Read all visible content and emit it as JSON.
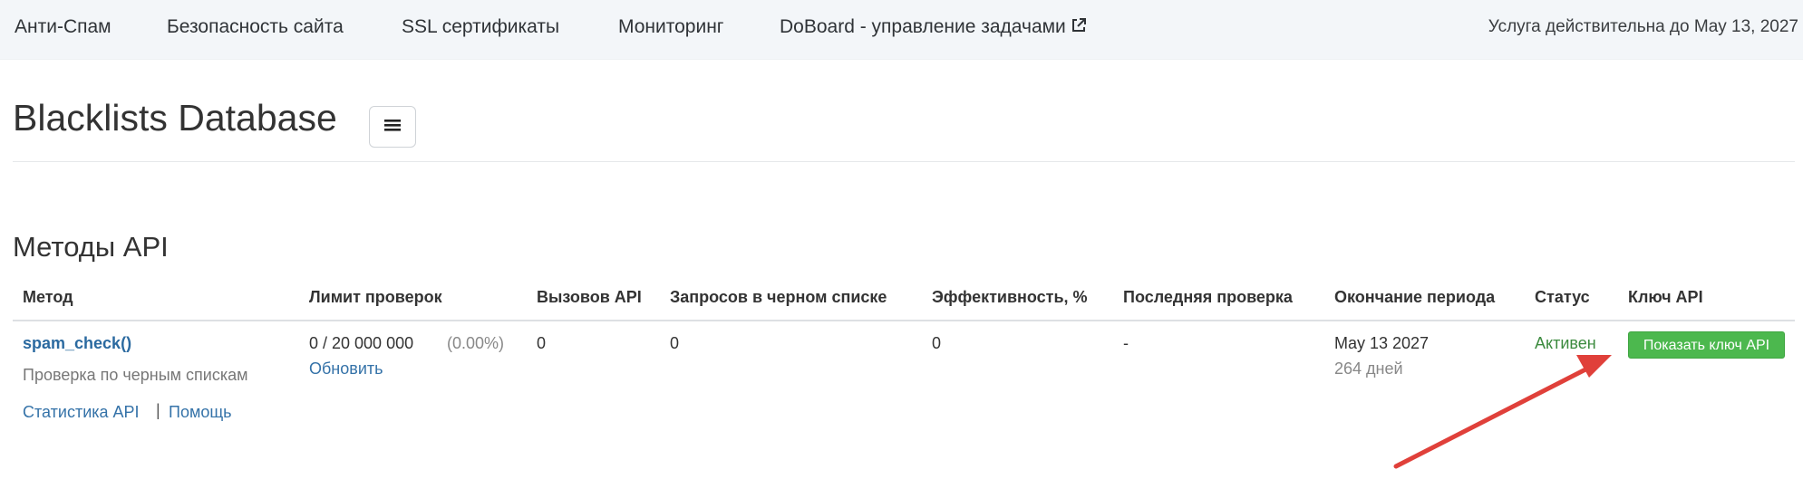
{
  "nav": {
    "items": [
      {
        "label": "Анти-Спам"
      },
      {
        "label": "Безопасность сайта"
      },
      {
        "label": "SSL сертификаты"
      },
      {
        "label": "Мониторинг"
      },
      {
        "label": "DoBoard - управление задачами",
        "icon": "external-link-icon"
      }
    ],
    "service_until": "Услуга действительна до May 13, 2027"
  },
  "page": {
    "title": "Blacklists Database",
    "menu_icon": "hamburger-icon"
  },
  "section": {
    "title": "Методы API"
  },
  "table": {
    "headers": [
      "Метод",
      "Лимит проверок",
      "Вызовов API",
      "Запросов в черном списке",
      "Эффективность, %",
      "Последняя проверка",
      "Окончание периода",
      "Статус",
      "Ключ API"
    ],
    "rows": [
      {
        "method": "spam_check()",
        "method_desc": "Проверка по черным спискам",
        "stats_link": "Статистика API",
        "separator": "|",
        "help_link": "Помощь",
        "limit": "0 / 20 000 000",
        "limit_percent": "(0.00%)",
        "update_link": "Обновить",
        "api_calls": "0",
        "blacklist_requests": "0",
        "efficiency": "0",
        "last_check": "-",
        "period_end": "May 13 2027",
        "days_left": "264 дней",
        "status": "Активен",
        "api_key_button": "Показать ключ API"
      }
    ]
  },
  "colors": {
    "nav_bg": "#f3f6f9",
    "link": "#3472a8",
    "status_active": "#3c8b3f",
    "button_green": "#4cb84e",
    "annotation_arrow": "#e0403a"
  }
}
